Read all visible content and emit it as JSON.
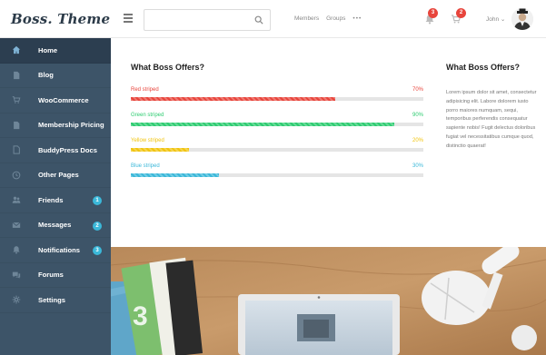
{
  "brand": {
    "name": "Boss. Theme"
  },
  "sidebar": {
    "items": [
      {
        "label": "Home",
        "icon": "home-icon",
        "active": true
      },
      {
        "label": "Blog",
        "icon": "document-icon"
      },
      {
        "label": "WooCommerce",
        "icon": "cart-icon"
      },
      {
        "label": "Membership Pricing",
        "icon": "document-icon"
      },
      {
        "label": "BuddyPress Docs",
        "icon": "document-outline-icon"
      },
      {
        "label": "Other Pages",
        "icon": "clock-icon"
      },
      {
        "label": "Friends",
        "icon": "users-icon",
        "badge": "1"
      },
      {
        "label": "Messages",
        "icon": "envelope-icon",
        "badge": "2"
      },
      {
        "label": "Notifications",
        "icon": "bell-icon",
        "badge": "3"
      },
      {
        "label": "Forums",
        "icon": "chat-icon"
      },
      {
        "label": "Settings",
        "icon": "gear-icon"
      }
    ]
  },
  "topbar": {
    "search_placeholder": "",
    "links": [
      "Members",
      "Groups"
    ],
    "more": "•••",
    "notifications_badge": "3",
    "cart_badge": "2",
    "user_name": "John",
    "user_chevron": "⌄"
  },
  "offers": {
    "title": "What Boss Offers?",
    "skills": [
      {
        "label": "Red striped",
        "percent": 70,
        "percent_text": "70%",
        "color": "#e8453c"
      },
      {
        "label": "Green striped",
        "percent": 90,
        "percent_text": "90%",
        "color": "#2ecc71"
      },
      {
        "label": "Yellow striped",
        "percent": 20,
        "percent_text": "20%",
        "color": "#f1c40f"
      },
      {
        "label": "Blue striped",
        "percent": 30,
        "percent_text": "30%",
        "color": "#3bb8d9"
      }
    ]
  },
  "sidebar_text": {
    "title": "What Boss Offers?",
    "body": "Lorem ipsum dolor sit amet, consectetur adipisicing elit. Labore dolorem iusto porro maiores numquam, sequi, temporibus perferendis consequatur sapiente nobis! Fugit delectus doloribus fugiat vel necessitatibus cumque quod, distinctio quaerat!"
  },
  "colors": {
    "sidebar_bg": "#3d5468",
    "sidebar_active": "#2c3e50",
    "accent_blue": "#3bb8d9",
    "badge_red": "#e8453c"
  }
}
